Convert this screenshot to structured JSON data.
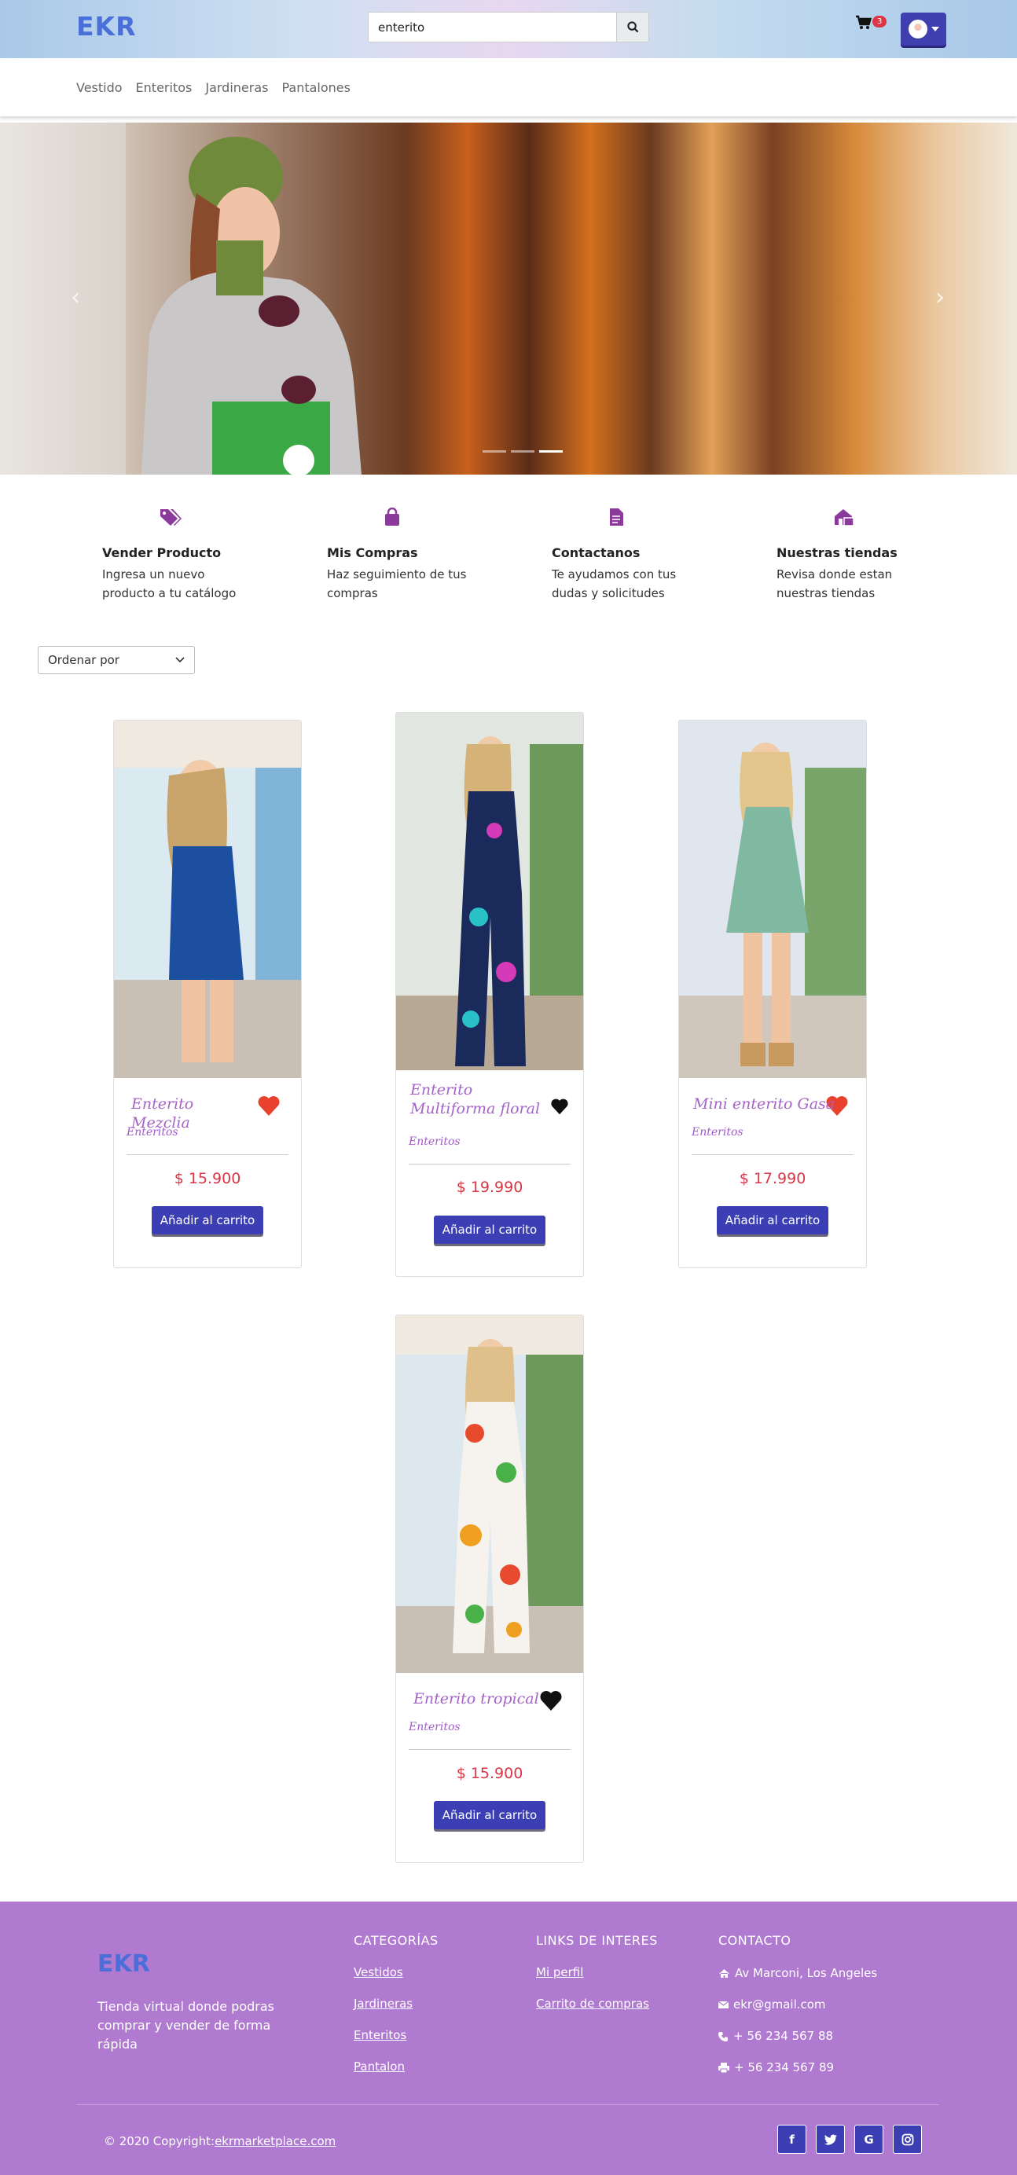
{
  "header": {
    "logo": "EKR",
    "search_value": "enterito",
    "cart_count": "3"
  },
  "categories_nav": [
    "Vestido",
    "Enteritos",
    "Jardineras",
    "Pantalones"
  ],
  "carousel": {
    "slides": 3,
    "active_slide": 2
  },
  "features": [
    {
      "title": "Vender Producto",
      "text": "Ingresa un nuevo producto a tu catálogo",
      "icon": "tags-icon"
    },
    {
      "title": "Mis Compras",
      "text": "Haz seguimiento de tus compras",
      "icon": "shopping-bag-icon"
    },
    {
      "title": "Contactanos",
      "text": "Te ayudamos con tus dudas y solicitudes",
      "icon": "document-icon"
    },
    {
      "title": "Nuestras tiendas",
      "text": "Revisa donde estan nuestras tiendas",
      "icon": "store-icon"
    }
  ],
  "sort": {
    "label": "Ordenar por"
  },
  "products": [
    {
      "name": "Enterito Mezclia",
      "category": "Enteritos",
      "price": "$ 15.900",
      "button": "Añadir al carrito",
      "favorite": true
    },
    {
      "name": "Enterito Multiforma floral",
      "category": "Enteritos",
      "price": "$ 19.990",
      "button": "Añadir al carrito",
      "favorite": false
    },
    {
      "name": "Mini enterito Gasa",
      "category": "Enteritos",
      "price": "$ 17.990",
      "button": "Añadir al carrito",
      "favorite": true
    },
    {
      "name": "Enterito tropical",
      "category": "Enteritos",
      "price": "$ 15.900",
      "button": "Añadir al carrito",
      "favorite": false
    }
  ],
  "footer": {
    "logo": "EKR",
    "description": "Tienda virtual donde podras comprar y vender de forma rápida",
    "categories_title": "CATEGORÍAS",
    "categories": [
      "Vestidos",
      "Jardineras",
      "Enteritos",
      "Pantalon"
    ],
    "links_title": "LINKS DE INTERES",
    "links": [
      "Mi perfil",
      "Carrito de compras"
    ],
    "contact_title": "CONTACTO",
    "contact": {
      "address": "Av Marconi, Los Angeles",
      "email": "ekr@gmail.com",
      "phone": "+ 56 234 567 88",
      "fax": "+ 56 234 567 89"
    },
    "copyright_prefix": "© 2020 Copyright:",
    "copyright_link": "ekrmarketplace.com",
    "socials": [
      "facebook-icon",
      "twitter-icon",
      "google-icon",
      "instagram-icon"
    ]
  },
  "colors": {
    "accent": "#3b3fb3",
    "purple": "#a463c6",
    "footer_bg": "#b07ad0",
    "price": "#dc3545",
    "logo": "#4a6fd8"
  }
}
